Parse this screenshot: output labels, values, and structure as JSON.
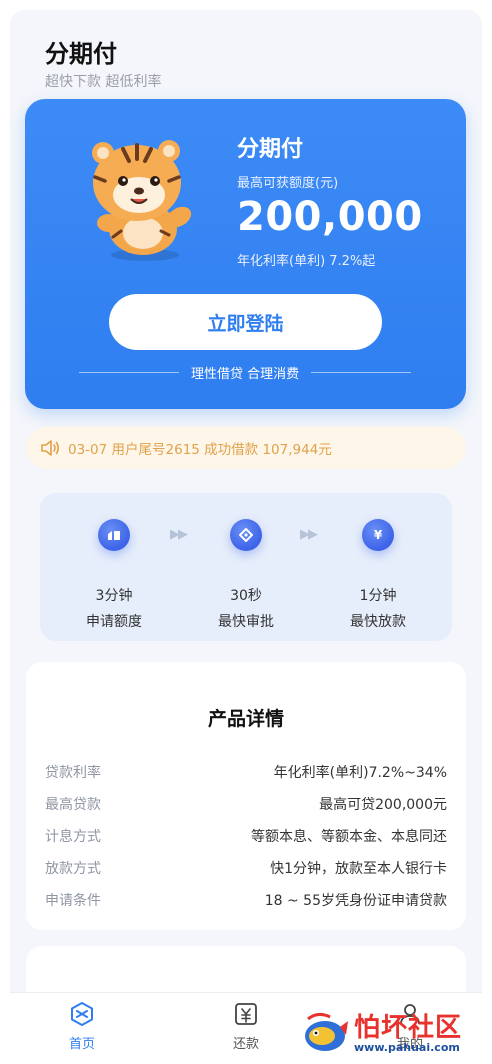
{
  "header": {
    "title": "分期付",
    "subtitle": "超快下款 超低利率"
  },
  "hero": {
    "title": "分期付",
    "limit_label": "最高可获额度(元)",
    "amount": "200,000",
    "rate_text": "年化利率(单利) 7.2%起",
    "login_button": "立即登陆",
    "slogan": "理性借贷 合理消费"
  },
  "notice": {
    "icon": "speaker-icon",
    "text": "03-07 用户尾号2615 成功借款 107,944元"
  },
  "steps": [
    {
      "icon": "apply-icon",
      "value": "3分钟",
      "label": "申请额度"
    },
    {
      "icon": "approve-icon",
      "value": "30秒",
      "label": "最快审批"
    },
    {
      "icon": "yuan-icon",
      "value": "1分钟",
      "label": "最快放款",
      "glyph": "¥"
    }
  ],
  "detail": {
    "title": "产品详情",
    "rows": [
      {
        "key": "贷款利率",
        "value": "年化利率(单利)7.2%~34%"
      },
      {
        "key": "最高贷款",
        "value": "最高可贷200,000元"
      },
      {
        "key": "计息方式",
        "value": "等额本息、等额本金、本息同还"
      },
      {
        "key": "放款方式",
        "value": "快1分钟，放款至本人银行卡"
      },
      {
        "key": "申请条件",
        "value": "18 ~ 55岁凭身份证申请贷款"
      }
    ]
  },
  "tabbar": {
    "items": [
      {
        "label": "首页",
        "icon": "home-icon",
        "active": true
      },
      {
        "label": "还款",
        "icon": "repay-icon",
        "active": false
      },
      {
        "label": "我的",
        "icon": "user-icon",
        "active": false
      }
    ]
  },
  "watermark": {
    "main": "怕坏社区",
    "url": "www.pahuai.com"
  },
  "colors": {
    "primary": "#2f7ef0",
    "notice_text": "#e0a24a",
    "notice_bg": "#fdf6e9",
    "step_icon": "#3c63e8"
  }
}
